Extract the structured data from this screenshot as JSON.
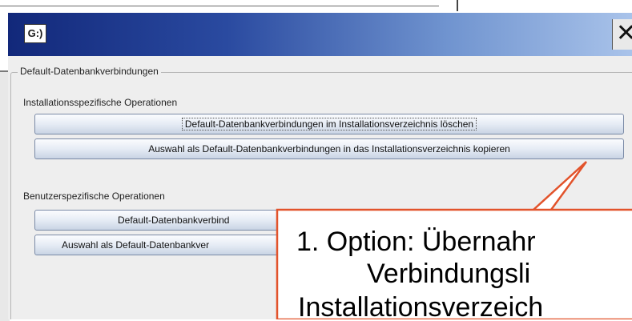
{
  "dialog": {
    "icon_text": "G:)",
    "close_glyph": "✕"
  },
  "group": {
    "title": "Default-Datenbankverbindungen",
    "install_section": {
      "label": "Installationsspezifische Operationen",
      "buttons": [
        "Default-Datenbankverbindungen im Installationsverzeichnis löschen",
        "Auswahl als Default-Datenbankverbindungen in das Installationsverzeichnis kopieren"
      ]
    },
    "user_section": {
      "label": "Benutzerspezifische Operationen",
      "buttons": [
        "Default-Datenbankverbind",
        "Auswahl als Default-Datenbankver"
      ]
    }
  },
  "callout": {
    "lines": [
      "1. Option: Übernahr",
      "Verbindungsli",
      "Installationsverzeich"
    ],
    "stroke_color": "#e2532b"
  }
}
